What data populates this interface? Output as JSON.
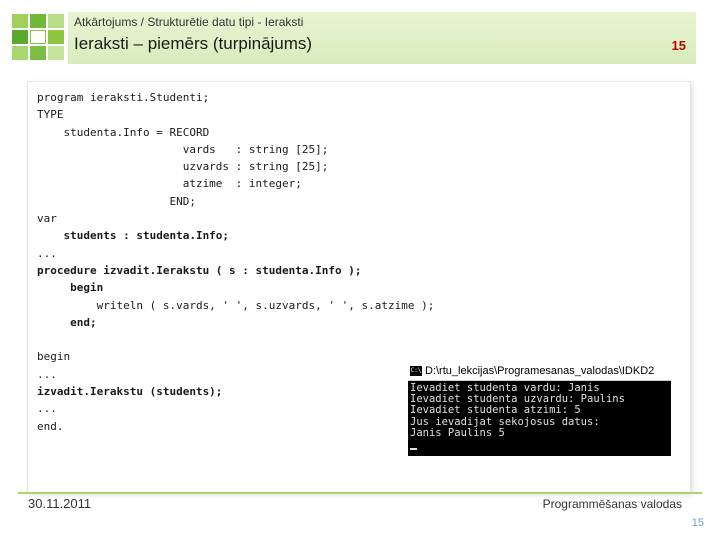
{
  "header": {
    "breadcrumb": "Atkārtojums / Strukturētie datu tipi - Ieraksti",
    "title": "Ieraksti – piemērs (turpinājums)",
    "slide_number": "15"
  },
  "code": {
    "l1": "program ieraksti.Studenti;",
    "l2": "TYPE",
    "l3": "    studenta.Info = RECORD",
    "l4": "                      vards   : string [25];",
    "l5": "                      uzvards : string [25];",
    "l6": "                      atzime  : integer;",
    "l7": "                    END;",
    "l8": "var",
    "l9": "    students : studenta.Info;",
    "l10": "...",
    "l11": "procedure izvadit.Ierakstu ( s : studenta.Info );",
    "l12": "     begin",
    "l13": "         writeln ( s.vards, ' ', s.uzvards, ' ', s.atzime );",
    "l14": "     end;",
    "l15": "",
    "l16": "begin",
    "l17": "...",
    "l18": "izvadit.Ierakstu (students);",
    "l19": "...",
    "l20": "end."
  },
  "console": {
    "title": "D:\\rtu_lekcijas\\Programesanas_valodas\\IDKD2",
    "icon": "cmd-icon",
    "lines": [
      "Ievadiet studenta vardu: Janis",
      "Ievadiet studenta uzvardu: Paulins",
      "Ievadiet studenta atzimi: 5",
      "Jus ievadijat sekojosus datus:",
      "Janis Paulins 5"
    ]
  },
  "footer": {
    "date": "30.11.2011",
    "course": "Programmēšanas valodas",
    "page": "15"
  },
  "colors": {
    "accent_green": "#8dc63f",
    "header_bg": "#dfefc6",
    "slide_number_red": "#c00000",
    "page_number_blue": "#6f9fd1"
  }
}
